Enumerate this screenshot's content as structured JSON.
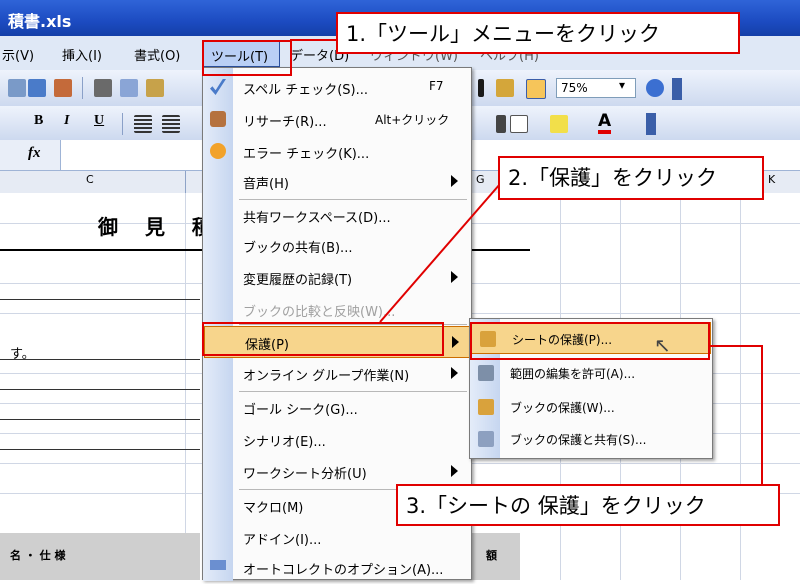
{
  "window": {
    "title": "積書.xls"
  },
  "menubar": {
    "items": [
      "示(V)",
      "挿入(I)",
      "書式(O)"
    ],
    "active": "ツール(T)",
    "behind": [
      "データ(D)",
      "ウィンドウ(W)",
      "ヘルプ(H)"
    ]
  },
  "toolbar": {
    "zoom": "75%",
    "bold": "B",
    "italic": "I",
    "underline": "U"
  },
  "formulabar": {
    "fx": "fx"
  },
  "columns": [
    "C",
    "G",
    "K"
  ],
  "sheet": {
    "title": "御 見 積",
    "text": "す。",
    "bottom_label": "名 ・ 仕 様",
    "bottom_right": "額"
  },
  "tools_menu": {
    "items": [
      {
        "label": "スペル チェック(S)...",
        "shortcut": "F7"
      },
      {
        "label": "リサーチ(R)...",
        "shortcut": "Alt+クリック"
      },
      {
        "label": "エラー チェック(K)..."
      },
      {
        "label": "音声(H)",
        "submenu": true
      },
      {
        "label": "共有ワークスペース(D)..."
      },
      {
        "label": "ブックの共有(B)..."
      },
      {
        "label": "変更履歴の記録(T)",
        "submenu": true
      },
      {
        "label": "ブックの比較と反映(W)...",
        "disabled": true
      },
      {
        "label": "保護(P)",
        "submenu": true,
        "highlighted": true
      },
      {
        "label": "オンライン グループ作業(N)",
        "submenu": true
      },
      {
        "label": "ゴール シーク(G)..."
      },
      {
        "label": "シナリオ(E)..."
      },
      {
        "label": "ワークシート分析(U)",
        "submenu": true
      },
      {
        "label": "マクロ(M)"
      },
      {
        "label": "アドイン(I)..."
      },
      {
        "label": "オートコレクトのオプション(A)..."
      }
    ]
  },
  "protect_submenu": {
    "items": [
      {
        "label": "シートの保護(P)...",
        "highlighted": true
      },
      {
        "label": "範囲の編集を許可(A)..."
      },
      {
        "label": "ブックの保護(W)..."
      },
      {
        "label": "ブックの保護と共有(S)..."
      }
    ]
  },
  "callouts": {
    "step1": "1.「ツール」メニューをクリック",
    "step2": "2.「保護」をクリック",
    "step3": "3.「シートの 保護」をクリック"
  },
  "colors": {
    "highlight": "#f7d58c",
    "callout_border": "#e00000",
    "titlebar": "#1c4bc1"
  }
}
